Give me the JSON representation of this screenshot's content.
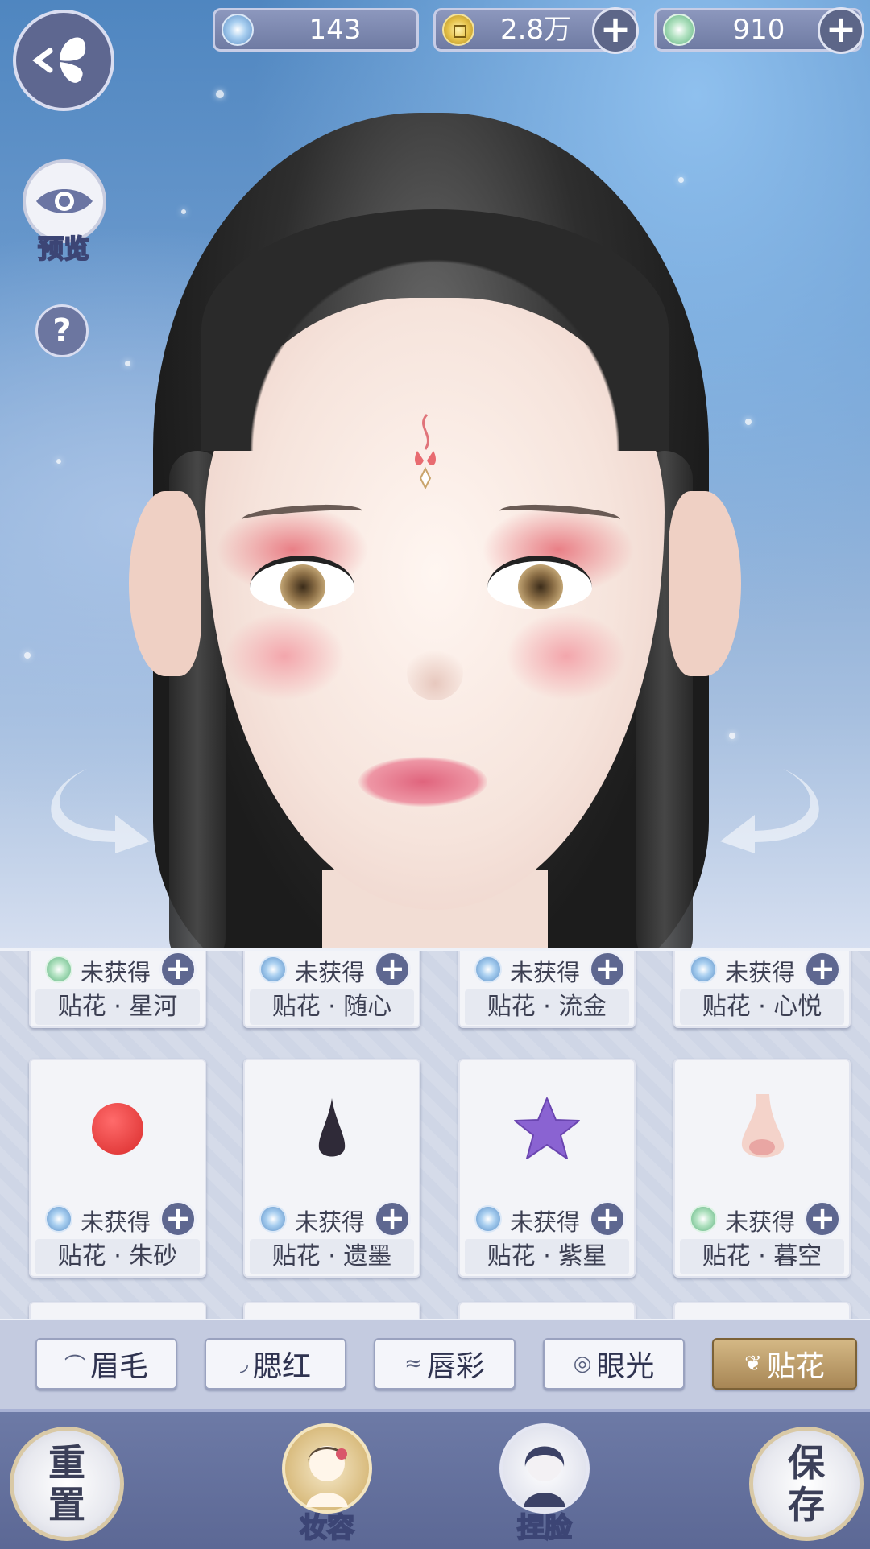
{
  "currency": [
    {
      "icon": "jade-coin-icon",
      "value": "143",
      "has_plus": false
    },
    {
      "icon": "gold-coin-icon",
      "value": "2.8万",
      "has_plus": true
    },
    {
      "icon": "dragon-jade-icon",
      "value": "910",
      "has_plus": true
    }
  ],
  "left_controls": {
    "preview_label": "预览",
    "help_symbol": "?"
  },
  "stickers_row1": [
    {
      "status": "未获得",
      "name": "贴花 · 星河",
      "gem": "green"
    },
    {
      "status": "未获得",
      "name": "贴花 · 随心",
      "gem": "blue"
    },
    {
      "status": "未获得",
      "name": "贴花 · 流金",
      "gem": "blue"
    },
    {
      "status": "未获得",
      "name": "贴花 · 心悦",
      "gem": "blue"
    }
  ],
  "stickers_row2": [
    {
      "status": "未获得",
      "name": "贴花 · 朱砂",
      "gem": "blue",
      "thumb": "red-dot-sticker"
    },
    {
      "status": "未获得",
      "name": "贴花 · 遗墨",
      "gem": "blue",
      "thumb": "ink-drop-sticker"
    },
    {
      "status": "未获得",
      "name": "贴花 · 紫星",
      "gem": "blue",
      "thumb": "purple-star-sticker"
    },
    {
      "status": "未获得",
      "name": "贴花 · 暮空",
      "gem": "green",
      "thumb": "nose-sticker"
    }
  ],
  "tabs": [
    {
      "label": "眉毛",
      "icon": "eyebrow-icon",
      "active": false
    },
    {
      "label": "腮红",
      "icon": "blush-icon",
      "active": false
    },
    {
      "label": "唇彩",
      "icon": "lips-icon",
      "active": false
    },
    {
      "label": "眼光",
      "icon": "eye-highlight-icon",
      "active": false
    },
    {
      "label": "贴花",
      "icon": "flower-icon",
      "active": true
    }
  ],
  "bottom": {
    "reset_top": "重",
    "reset_bottom": "置",
    "makeup_label": "妆容",
    "face_label": "捏脸",
    "save_top": "保",
    "save_bottom": "存"
  },
  "colors": {
    "accent_gold": "#a78655",
    "panel_bg": "#cfd6e6",
    "button_navy": "#5e6790"
  }
}
